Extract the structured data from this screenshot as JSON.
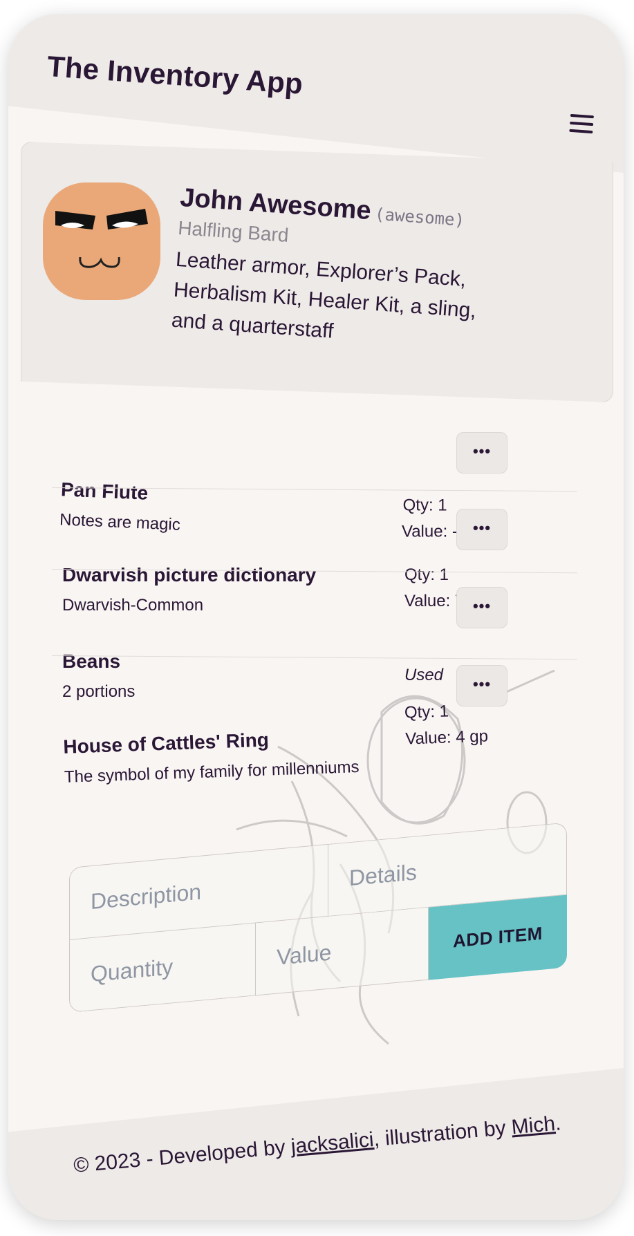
{
  "app": {
    "title": "The Inventory App"
  },
  "profile": {
    "name": "John Awesome",
    "handle": "(awesome)",
    "class": "Halfling Bard",
    "description": "Leather armor, Explorer’s Pack, Herbalism Kit, Healer Kit, a sling, and a quarterstaff"
  },
  "items": [
    {
      "name": "Pan Flute",
      "details": "Notes are magic",
      "qty": "Qty: 1",
      "value": "Value: -",
      "menu": "•••"
    },
    {
      "name": "Dwarvish picture dictionary",
      "details": "Dwarvish-Common",
      "qty": "Qty: 1",
      "value": "Value: 7 cp",
      "menu": "•••"
    },
    {
      "name": "Beans",
      "details": "2 portions",
      "status": "Used",
      "menu": "•••"
    },
    {
      "name": "House of Cattles' Ring",
      "details": "The symbol of my family for millenniums",
      "qty": "Qty: 1",
      "value": "Value: 4 gp",
      "menu": "•••"
    }
  ],
  "form": {
    "description_placeholder": "Description",
    "details_placeholder": "Details",
    "quantity_placeholder": "Quantity",
    "value_placeholder": "Value",
    "add_label": "ADD ITEM"
  },
  "footer": {
    "prefix": "© 2023 - Developed by ",
    "developer": "jacksalici",
    "middle": ", illustration by ",
    "illustrator": "Mich",
    "suffix": "."
  },
  "colors": {
    "accent": "#66c2c5",
    "text": "#2a1635",
    "avatar": "#eaa878"
  },
  "icons": [
    "menu-icon",
    "avatar-icon",
    "more-icon",
    "bard-illustration"
  ]
}
